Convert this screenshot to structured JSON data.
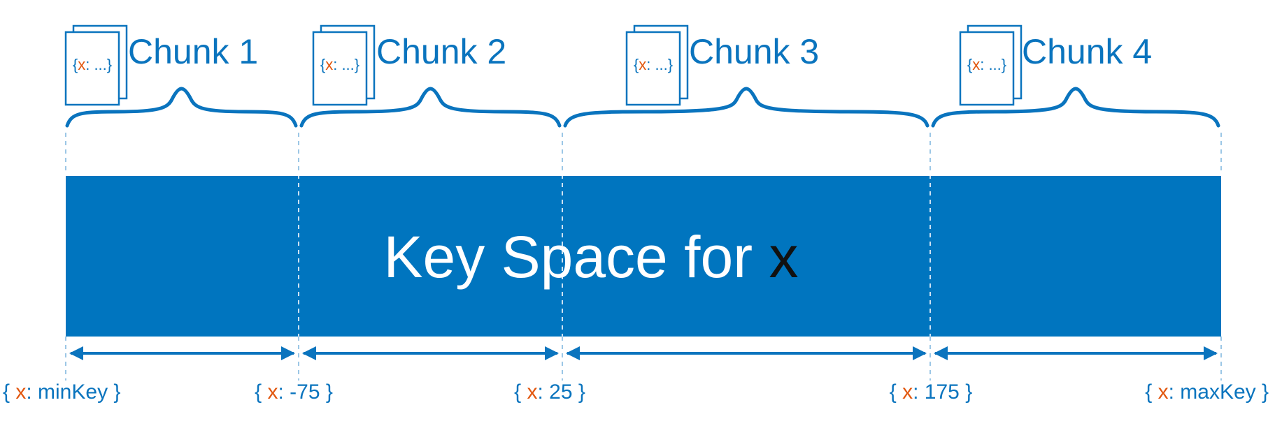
{
  "colors": {
    "accent": "#0A74BE",
    "bar": "#0075BF",
    "key_highlight": "#E2570F",
    "guide": "#9CC7E6",
    "title_text": "#ffffff",
    "title_variable": "#111111"
  },
  "icons": {
    "chunk": "document-stack-icon",
    "arrow": "double-headed-arrow-icon",
    "brace": "curly-brace-icon"
  },
  "diagram": {
    "title": "Key Space for ",
    "title_variable": "x",
    "doc_open": "{",
    "doc_key": "x",
    "doc_rest": ": ...}",
    "chunks": [
      {
        "label": "Chunk 1"
      },
      {
        "label": "Chunk 2"
      },
      {
        "label": "Chunk 3"
      },
      {
        "label": "Chunk 4"
      }
    ],
    "bounds": [
      {
        "open": "{ ",
        "key": "x",
        "rest": ": minKey }"
      },
      {
        "open": "{ ",
        "key": "x",
        "rest": ": -75 }"
      },
      {
        "open": "{ ",
        "key": "x",
        "rest": ": 25 }"
      },
      {
        "open": "{ ",
        "key": "x",
        "rest": ": 175 }"
      },
      {
        "open": "{ ",
        "key": "x",
        "rest": ": maxKey }"
      }
    ]
  }
}
